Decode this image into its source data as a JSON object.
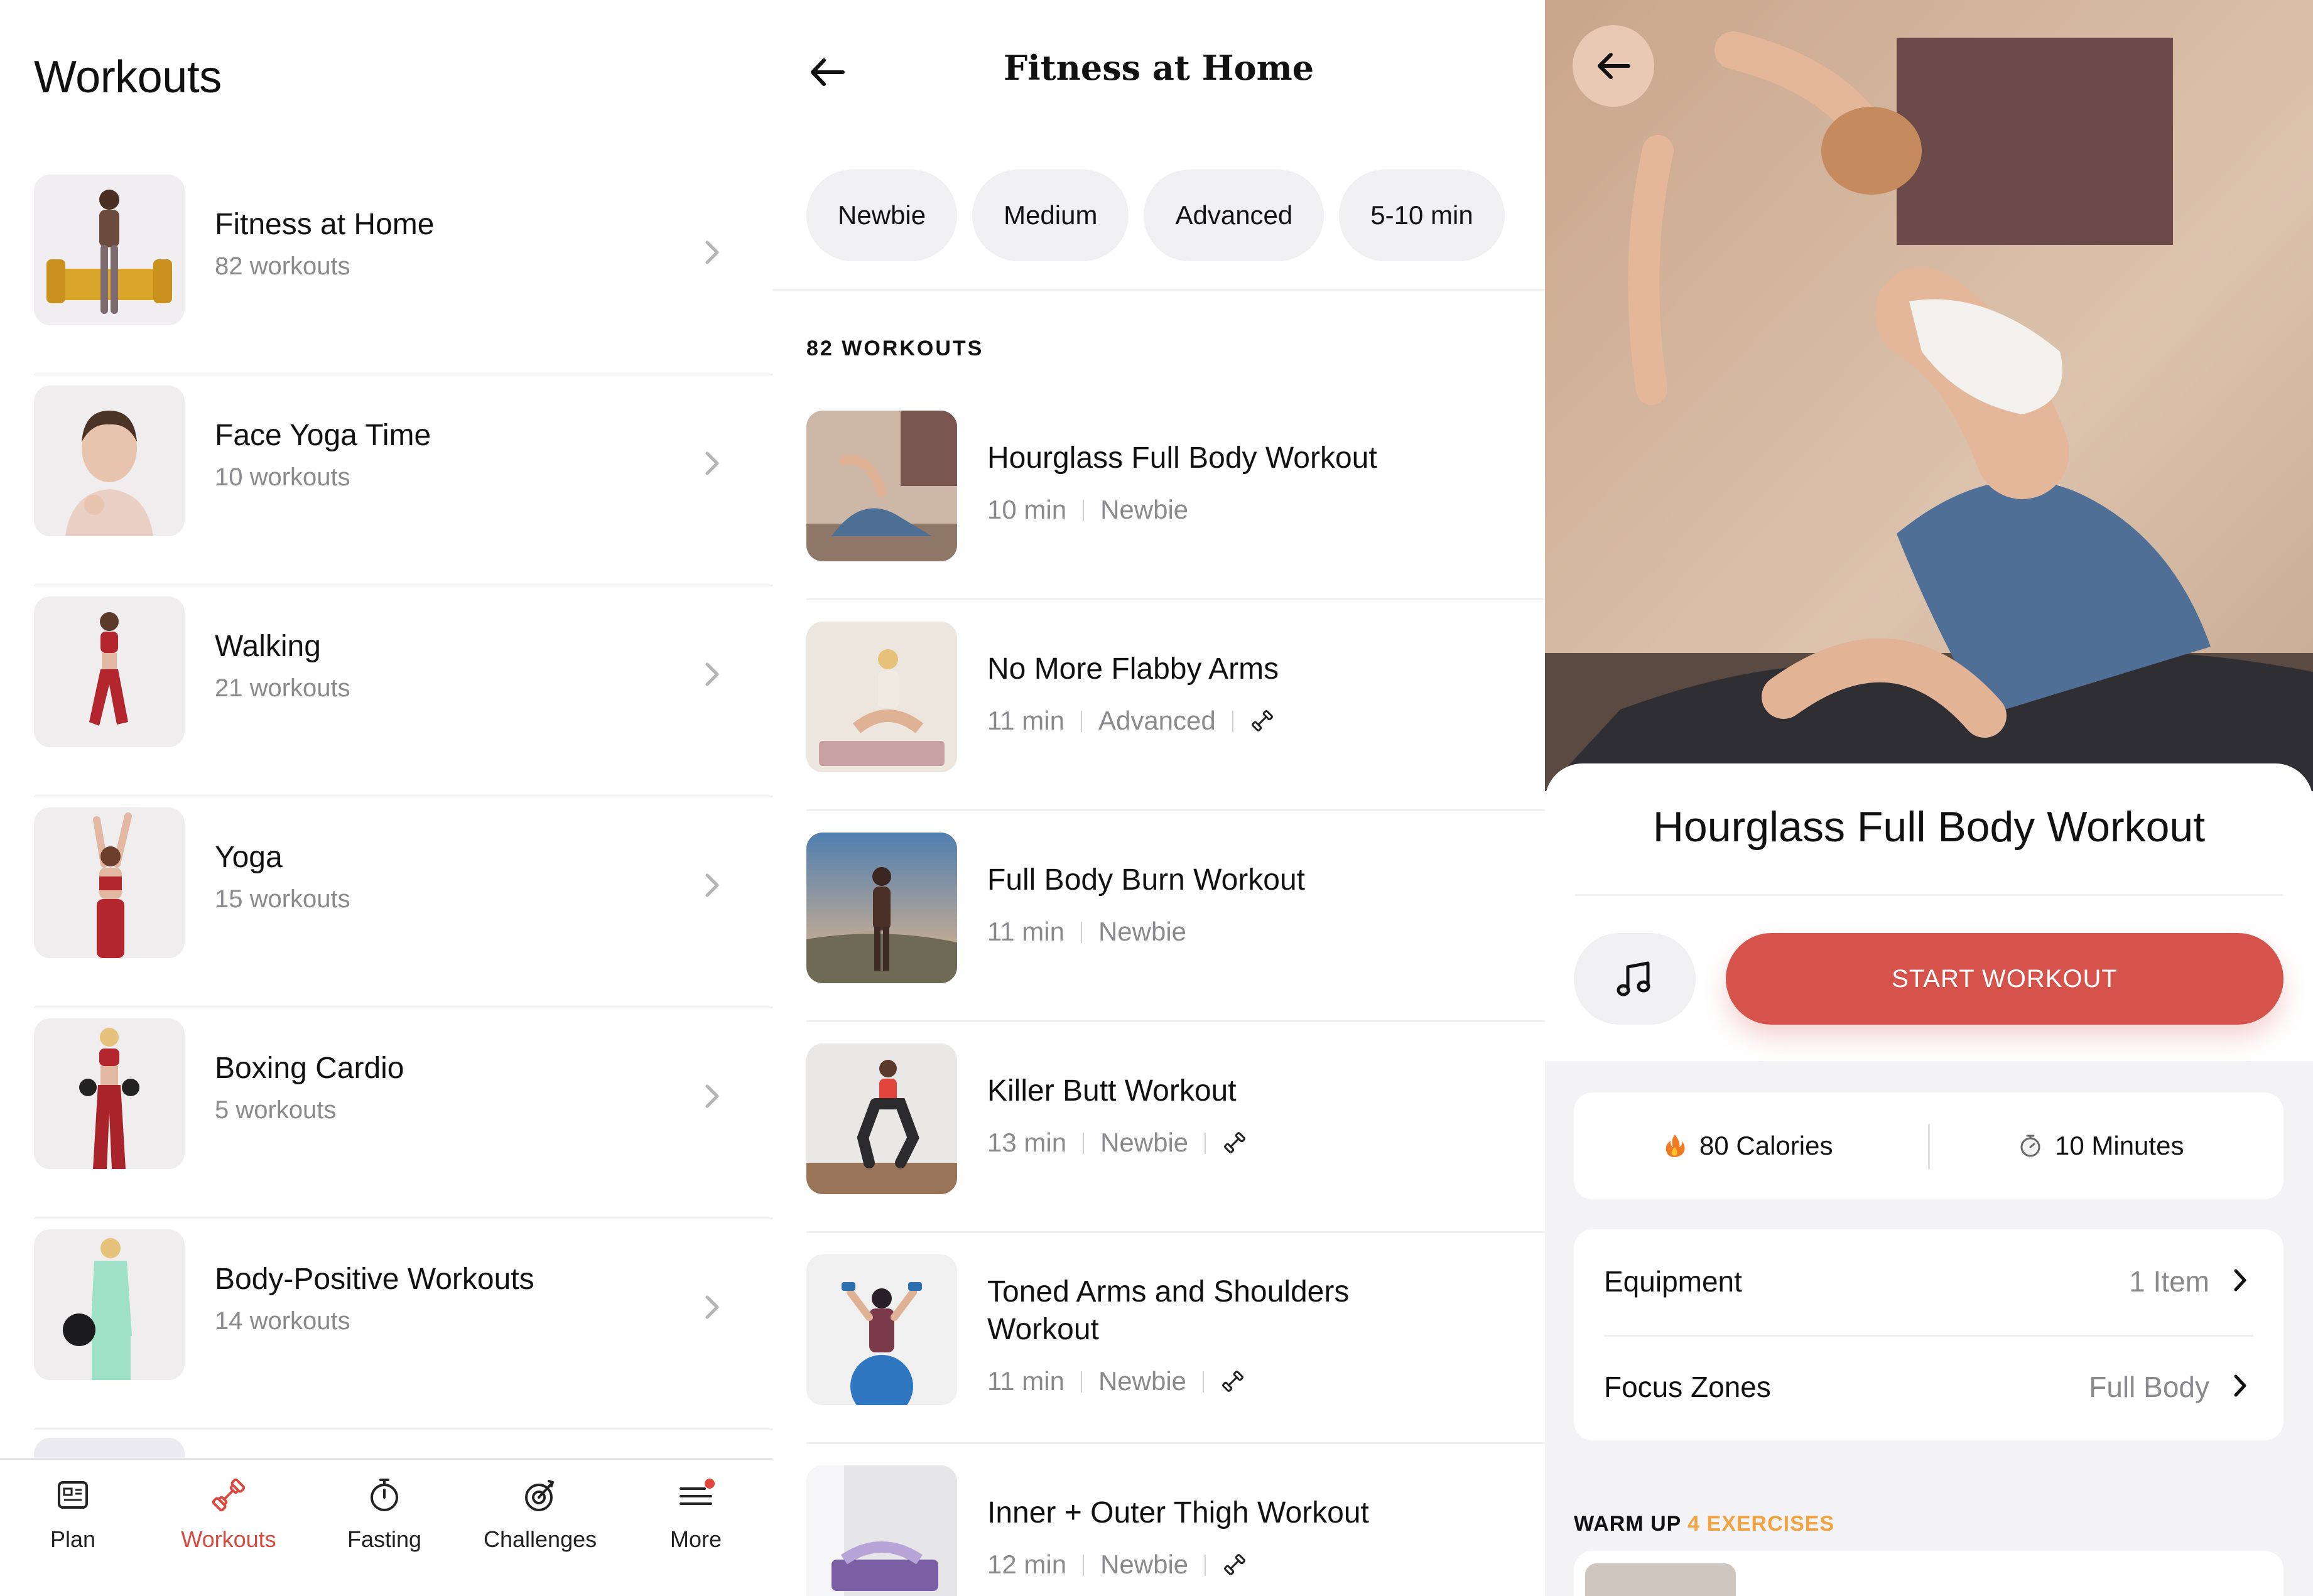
{
  "screen1": {
    "title": "Workouts",
    "categories": [
      {
        "name": "Fitness at Home",
        "count": "82 workouts"
      },
      {
        "name": "Face Yoga Time",
        "count": "10 workouts"
      },
      {
        "name": "Walking",
        "count": "21 workouts"
      },
      {
        "name": "Yoga",
        "count": "15 workouts"
      },
      {
        "name": "Boxing Cardio",
        "count": "5 workouts"
      },
      {
        "name": "Body-Positive Workouts",
        "count": "14 workouts"
      }
    ],
    "tabs": [
      {
        "label": "Plan",
        "icon": "plan-icon",
        "active": false
      },
      {
        "label": "Workouts",
        "icon": "dumbbell-icon",
        "active": true
      },
      {
        "label": "Fasting",
        "icon": "stopwatch-icon",
        "active": false
      },
      {
        "label": "Challenges",
        "icon": "target-icon",
        "active": false
      },
      {
        "label": "More",
        "icon": "menu-icon",
        "active": false
      }
    ],
    "accent": "#d84a3f"
  },
  "screen2": {
    "title": "Fitness at Home",
    "filters": [
      "Newbie",
      "Medium",
      "Advanced",
      "5-10 min"
    ],
    "count_label": "82 WORKOUTS",
    "workouts": [
      {
        "name": "Hourglass Full Body Workout",
        "duration": "10 min",
        "level": "Newbie",
        "equipment": false
      },
      {
        "name": "No More Flabby Arms",
        "duration": "11 min",
        "level": "Advanced",
        "equipment": true
      },
      {
        "name": "Full Body Burn Workout",
        "duration": "11 min",
        "level": "Newbie",
        "equipment": false
      },
      {
        "name": "Killer Butt Workout",
        "duration": "13 min",
        "level": "Newbie",
        "equipment": true
      },
      {
        "name": "Toned Arms and Shoulders Workout",
        "duration": "11 min",
        "level": "Newbie",
        "equipment": true
      },
      {
        "name": "Inner + Outer Thigh Workout",
        "duration": "12 min",
        "level": "Newbie",
        "equipment": true
      }
    ]
  },
  "screen3": {
    "title": "Hourglass Full Body Workout",
    "start_label": "START WORKOUT",
    "calories": "80 Calories",
    "minutes": "10 Minutes",
    "equipment_label": "Equipment",
    "equipment_value": "1 Item",
    "focus_label": "Focus Zones",
    "focus_value": "Full Body",
    "warmup_label": "WARM UP",
    "warmup_count": "4 EXERCISES",
    "start_color": "#d5534b",
    "warmup_accent": "#f0a340"
  }
}
